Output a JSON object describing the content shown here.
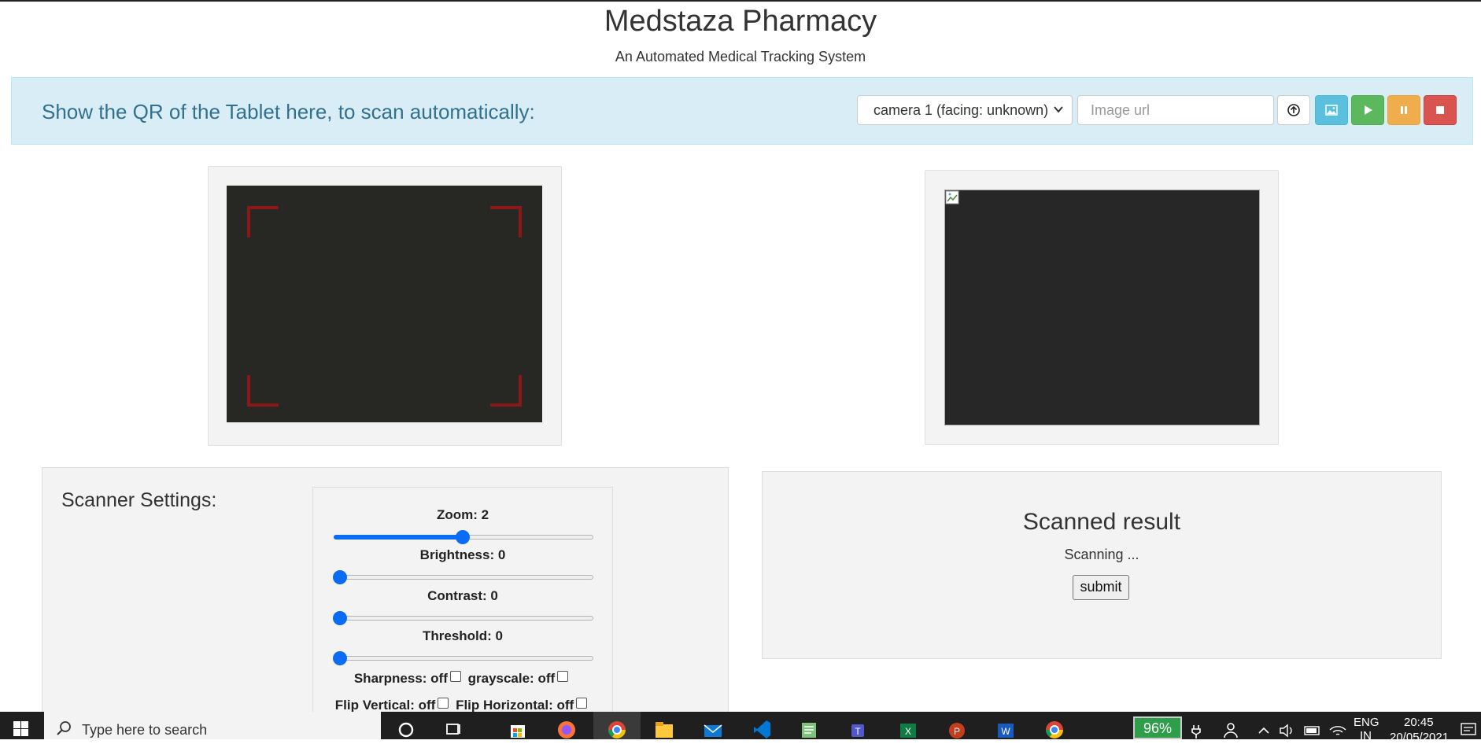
{
  "header": {
    "title": "Medstaza Pharmacy",
    "subtitle": "An Automated Medical Tracking System"
  },
  "scan_panel": {
    "instruction": "Show the QR of the Tablet here, to scan automatically:",
    "camera_select_value": "camera 1 (facing: unknown)",
    "image_url_placeholder": "Image url",
    "buttons": [
      {
        "name": "upload-url-button",
        "icon": "upload-circle-icon",
        "color": "#ffffff"
      },
      {
        "name": "image-button",
        "icon": "image-icon",
        "color": "#5bc0de"
      },
      {
        "name": "play-button",
        "icon": "play-icon",
        "color": "#5cb85c"
      },
      {
        "name": "pause-button",
        "icon": "pause-icon",
        "color": "#f0ad4e"
      },
      {
        "name": "stop-button",
        "icon": "stop-icon",
        "color": "#d9534f"
      }
    ]
  },
  "scanner_settings": {
    "title": "Scanner Settings:",
    "sliders": [
      {
        "label": "Zoom: 2",
        "value": 2,
        "min": 1,
        "max": 3
      },
      {
        "label": "Brightness: 0",
        "value": 0
      },
      {
        "label": "Contrast: 0",
        "value": 0
      },
      {
        "label": "Threshold: 0",
        "value": 0
      }
    ],
    "toggles_row1": [
      "Sharpness: off",
      "grayscale: off"
    ],
    "toggles_row2": [
      "Flip Vertical: off",
      "Flip Horizontal: off"
    ]
  },
  "result": {
    "title": "Scanned result",
    "status": "Scanning ...",
    "submit_label": "submit"
  },
  "taskbar": {
    "search_placeholder": "Type here to search",
    "battery": "96%",
    "language": "ENG",
    "region": "IN",
    "time": "20:45",
    "date": "20/05/2021",
    "apps": [
      "cortana-icon",
      "task-view-icon",
      "store-icon",
      "firefox-icon",
      "chrome-icon",
      "file-explorer-icon",
      "mail-icon",
      "vscode-icon",
      "notepad-icon",
      "teams-icon",
      "excel-icon",
      "powerpoint-icon",
      "word-icon",
      "chrome-icon"
    ]
  }
}
